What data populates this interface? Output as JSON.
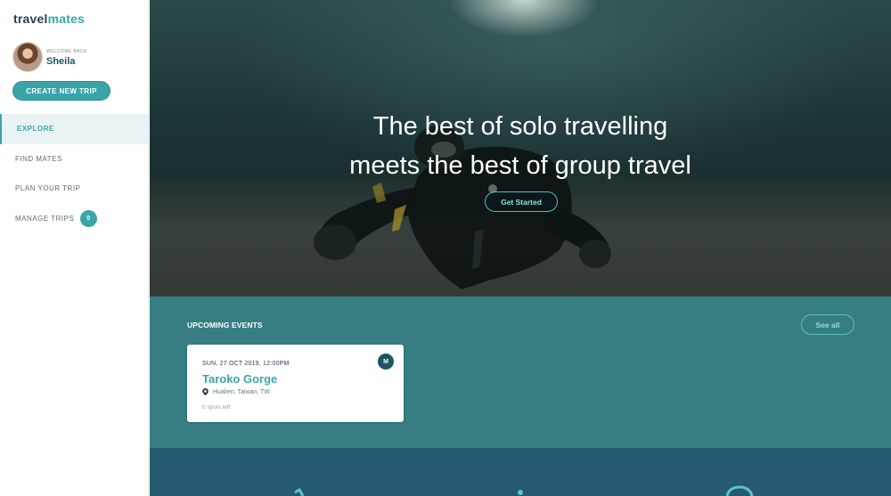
{
  "brand": {
    "part1": "travel",
    "part2": "mates"
  },
  "user": {
    "welcome": "WELCOME BACK",
    "name": "Sheila"
  },
  "sidebar": {
    "create_button": "CREATE NEW TRIP",
    "items": [
      {
        "label": "EXPLORE",
        "active": true
      },
      {
        "label": "FIND MATES"
      },
      {
        "label": "PLAN YOUR TRIP"
      },
      {
        "label": "MANAGE TRIPS",
        "badge": "0"
      }
    ]
  },
  "hero": {
    "line1": "The best of solo travelling",
    "line2": "meets the best of group travel",
    "button": "Get Started"
  },
  "events": {
    "title": "UPCOMING EVENTS",
    "see_all": "See all",
    "items": [
      {
        "date": "SUN, 27 OCT 2019, 12:00PM",
        "title": "Taroko Gorge",
        "location": "Hualien, Taiwan, TW",
        "spots": "0 spots left",
        "initial": "M"
      }
    ]
  },
  "colors": {
    "accent": "#3aa5a8",
    "dark": "#1e5566",
    "events_bg": "#367e82",
    "bottom_bg": "#255a70"
  },
  "icons": {
    "location": "map-pin-icon"
  }
}
